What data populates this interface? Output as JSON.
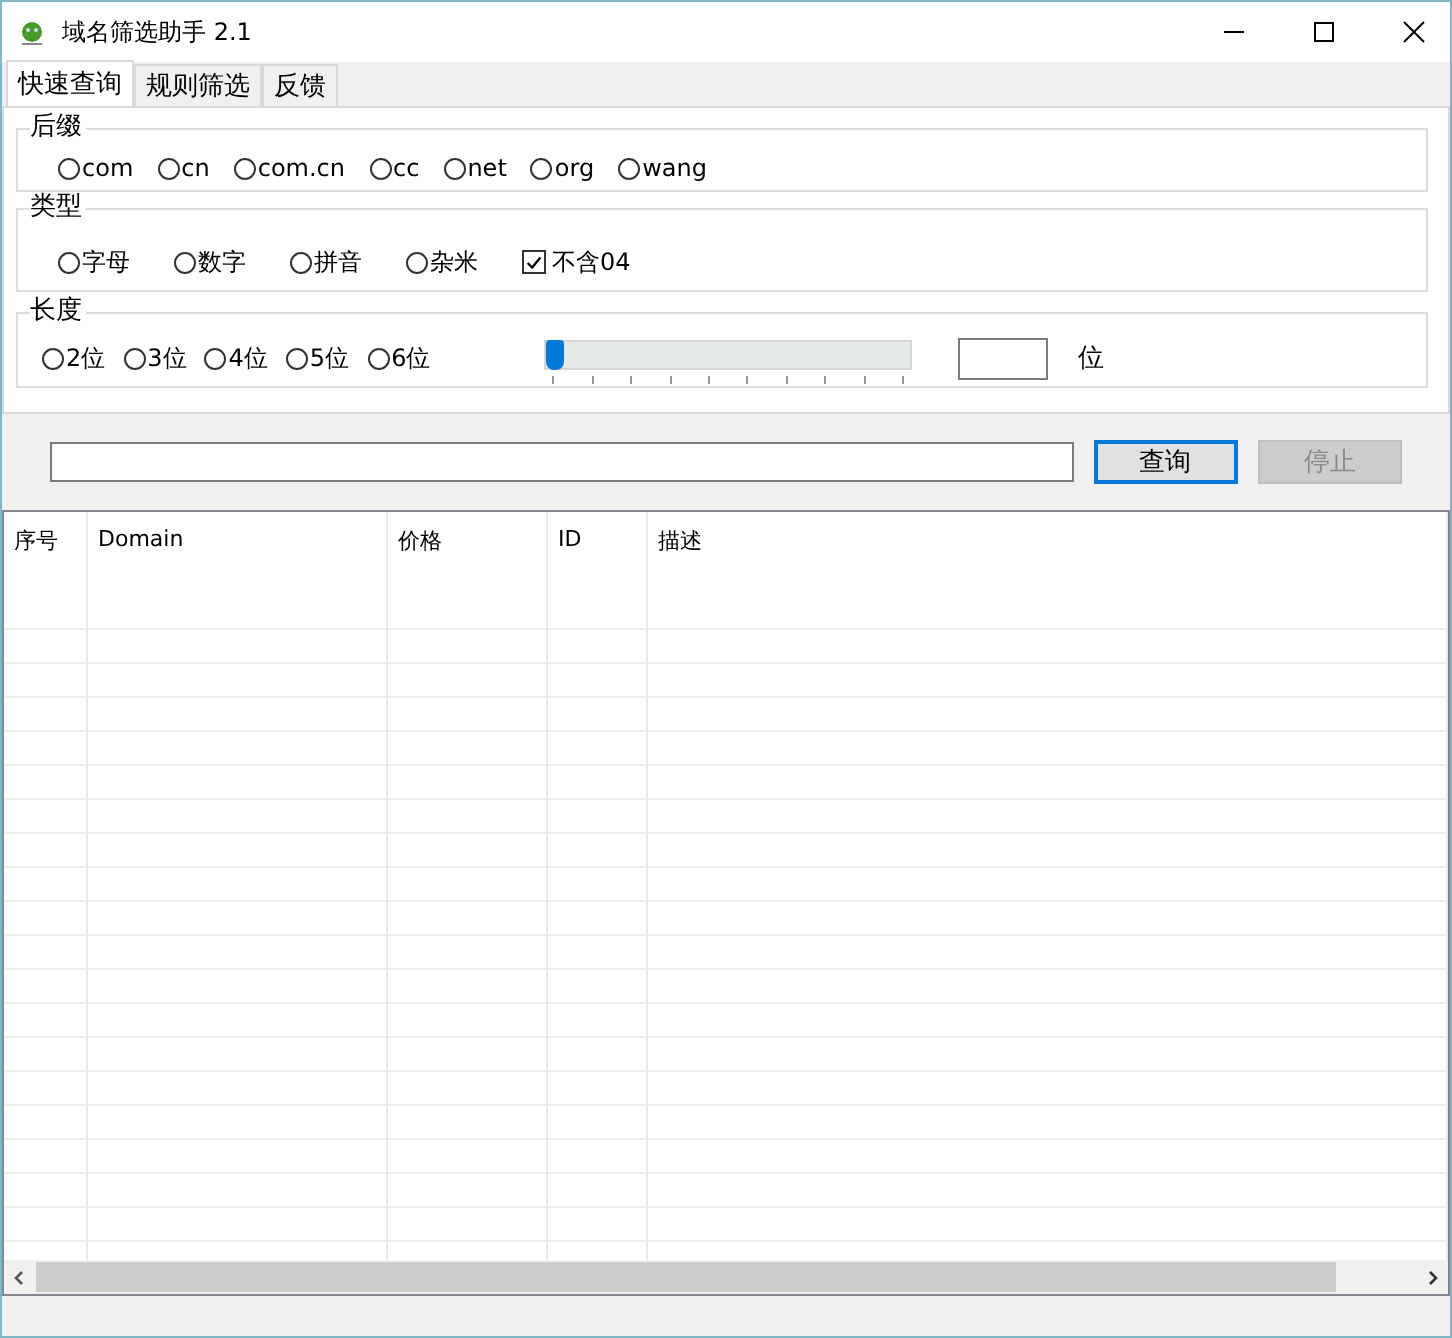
{
  "window": {
    "title": "域名筛选助手 2.1"
  },
  "tabs": [
    {
      "label": "快速查询",
      "selected": true
    },
    {
      "label": "规则筛选",
      "selected": false
    },
    {
      "label": "反馈",
      "selected": false
    }
  ],
  "suffix_group": {
    "title": "后缀",
    "options": [
      {
        "label": "com",
        "selected": false
      },
      {
        "label": "cn",
        "selected": false
      },
      {
        "label": "com.cn",
        "selected": false
      },
      {
        "label": "cc",
        "selected": false
      },
      {
        "label": "net",
        "selected": false
      },
      {
        "label": "org",
        "selected": false
      },
      {
        "label": "wang",
        "selected": false
      }
    ]
  },
  "type_group": {
    "title": "类型",
    "options": [
      {
        "kind": "radio",
        "label": "字母",
        "selected": false
      },
      {
        "kind": "radio",
        "label": "数字",
        "selected": false
      },
      {
        "kind": "radio",
        "label": "拼音",
        "selected": false
      },
      {
        "kind": "radio",
        "label": "杂米",
        "selected": false
      },
      {
        "kind": "checkbox",
        "label": "不含04",
        "checked": true
      }
    ]
  },
  "length_group": {
    "title": "长度",
    "options": [
      {
        "label": "2位",
        "selected": false
      },
      {
        "label": "3位",
        "selected": false
      },
      {
        "label": "4位",
        "selected": false
      },
      {
        "label": "5位",
        "selected": false
      },
      {
        "label": "6位",
        "selected": false
      }
    ],
    "slider": {
      "level": 0
    },
    "unit": "位"
  },
  "search": {
    "query_button": {
      "label": "查询",
      "disabled": false
    },
    "stop_button": {
      "label": "停止",
      "disabled": true
    }
  },
  "table": {
    "columns": [
      "序号",
      "Domain",
      "价格",
      "ID",
      "描述"
    ]
  }
}
